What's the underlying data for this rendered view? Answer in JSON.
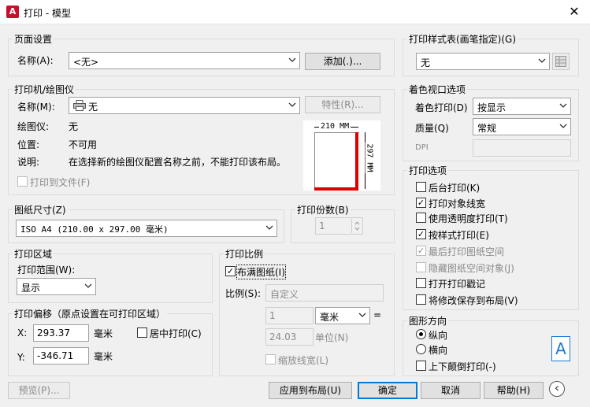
{
  "window": {
    "title": "打印 - 模型",
    "close": "✕"
  },
  "page_setup": {
    "group": "页面设置",
    "name_label": "名称(A):",
    "name_value": "<无>",
    "add_button": "添加(.)..."
  },
  "printer": {
    "group": "打印机/绘图仪",
    "name_label": "名称(M):",
    "name_value": "无",
    "properties_button": "特性(R)...",
    "plotter_label": "绘图仪:",
    "plotter_value": "无",
    "location_label": "位置:",
    "location_value": "不可用",
    "description_label": "说明:",
    "description_value": "在选择新的绘图仪配置名称之前，不能打印该布局。",
    "print_to_file": "打印到文件(F)",
    "preview_width": "210 MM",
    "preview_height": "297 MM"
  },
  "paper": {
    "group": "图纸尺寸(Z)",
    "value": "ISO A4 (210.00 x 297.00 毫米)"
  },
  "copies": {
    "group": "打印份数(B)",
    "value": "1"
  },
  "area": {
    "group": "打印区域",
    "range_label": "打印范围(W):",
    "range_value": "显示"
  },
  "offset": {
    "group": "打印偏移（原点设置在可打印区域）",
    "x_label": "X:",
    "x_value": "293.37",
    "x_unit": "毫米",
    "y_label": "Y:",
    "y_value": "-346.71",
    "y_unit": "毫米",
    "center": "居中打印(C)"
  },
  "scale": {
    "group": "打印比例",
    "fit": "布满图纸(I)",
    "scale_label": "比例(S):",
    "scale_value": "自定义",
    "num_value": "1",
    "unit_value": "毫米",
    "equals": "=",
    "den_value": "24.03",
    "unit_label": "单位(N)",
    "lineweights": "缩放线宽(L)"
  },
  "style_table": {
    "group": "打印样式表(画笔指定)(G)",
    "value": "无"
  },
  "shaded": {
    "group": "着色视口选项",
    "shade_label": "着色打印(D)",
    "shade_value": "按显示",
    "quality_label": "质量(Q)",
    "quality_value": "常规",
    "dpi_label": "DPI"
  },
  "options": {
    "group": "打印选项",
    "items": [
      "后台打印(K)",
      "打印对象线宽",
      "使用透明度打印(T)",
      "按样式打印(E)",
      "最后打印图纸空间",
      "隐藏图纸空间对象(J)",
      "打开打印戳记",
      "将修改保存到布局(V)"
    ],
    "check": "✓"
  },
  "orientation": {
    "group": "图形方向",
    "portrait": "纵向",
    "landscape": "横向",
    "upside_down": "上下颠倒打印(-)",
    "icon_letter": "A"
  },
  "footer": {
    "preview": "预览(P)...",
    "apply": "应用到布局(U)",
    "ok": "确定",
    "cancel": "取消",
    "help": "帮助(H)",
    "collapse": "‹"
  }
}
